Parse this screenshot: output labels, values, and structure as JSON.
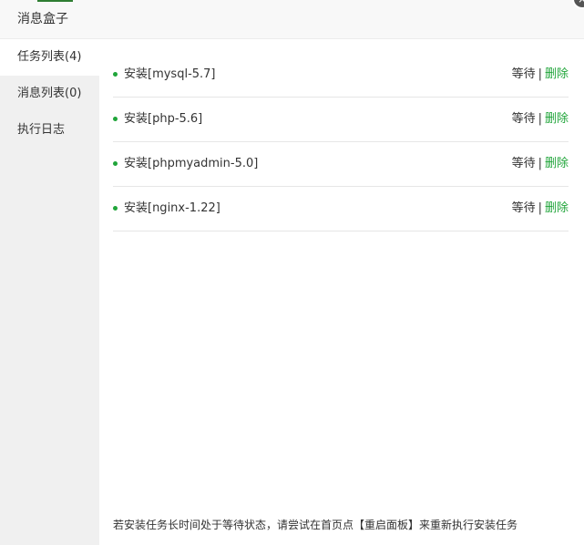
{
  "dialog": {
    "title": "消息盒子",
    "close_glyph": "×"
  },
  "sidebar": {
    "items": [
      {
        "label": "任务列表(4)",
        "active": true
      },
      {
        "label": "消息列表(0)",
        "active": false
      },
      {
        "label": "执行日志",
        "active": false
      }
    ]
  },
  "tasks": [
    {
      "name": "安装[mysql-5.7]",
      "status": "等待",
      "separator": "|",
      "delete_label": "删除"
    },
    {
      "name": "安装[php-5.6]",
      "status": "等待",
      "separator": "|",
      "delete_label": "删除"
    },
    {
      "name": "安装[phpmyadmin-5.0]",
      "status": "等待",
      "separator": "|",
      "delete_label": "删除"
    },
    {
      "name": "安装[nginx-1.22]",
      "status": "等待",
      "separator": "|",
      "delete_label": "删除"
    }
  ],
  "footer": {
    "note": "若安装任务长时间处于等待状态，请尝试在首页点【重启面板】来重新执行安装任务"
  },
  "colors": {
    "accent_green": "#20a53a",
    "sidebar_bg": "#f0f0f0",
    "titlebar_bg": "#f8f8f8"
  }
}
